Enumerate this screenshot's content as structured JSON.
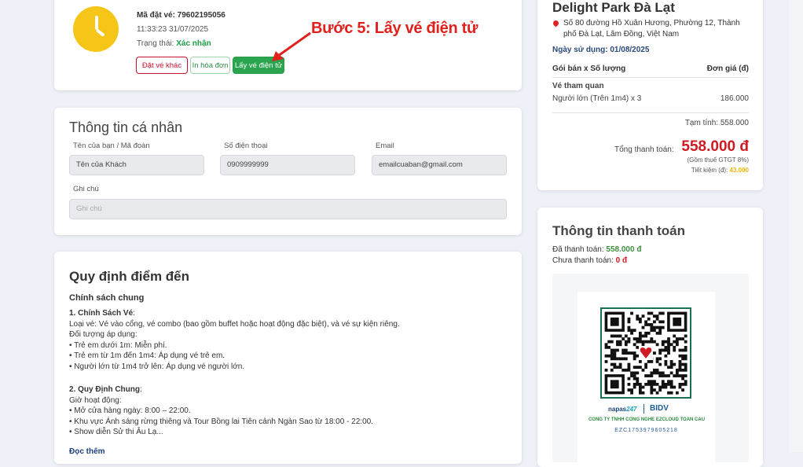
{
  "ticket": {
    "code_label": "Mã đặt vé: 79602195056",
    "datetime": "11:33:23 31/07/2025",
    "status_label": "Trạng thái: ",
    "status_value": "Xác nhận",
    "btn_book_again": "Đặt vé khác",
    "btn_print": "In hóa đơn",
    "btn_eticket": "Lấy vé điện tử"
  },
  "annotation": "Bước 5: Lấy vé điện tử",
  "personal": {
    "title": "Thông tin cá nhân",
    "name_label": "Tên của bạn / Mã đoàn",
    "name_value": "Tên của Khách",
    "phone_label": "Số điện thoại",
    "phone_value": "0909999999",
    "email_label": "Email",
    "email_value": "emailcuaban@gmail.com",
    "note_label": "Ghi chú",
    "note_placeholder": "Ghi chú"
  },
  "policy": {
    "title": "Quy định điểm đến",
    "subtitle": "Chính sách chung",
    "s1_title": "1. Chính Sách Vé",
    "s1_colon": ":",
    "s1_l1": "Loại vé: Vé vào cổng, vé combo (bao gồm buffet hoặc hoạt động đặc biệt), và vé sự kiện riêng.",
    "s1_l2": "Đối tượng áp dụng:",
    "s1_l3": "• Trẻ em dưới 1m: Miễn phí.",
    "s1_l4": "• Trẻ em từ 1m đến 1m4: Áp dụng vé trẻ em.",
    "s1_l5": "• Người lớn từ 1m4 trở lên: Áp dụng vé người lớn.",
    "s2_title": "2. Quy Định Chung",
    "s2_colon": ":",
    "s2_l1": "Giờ hoạt động:",
    "s2_l2": "• Mở cửa hàng ngày: 8:00 – 22:00.",
    "s2_l3": "• Khu vực Ánh sáng rừng thiêng và Tour Bồng lai Tiên cảnh Ngàn Sao từ 18:00 - 22:00.",
    "s2_l4": "• Show diễn Sử thi Âu Lạ...",
    "read_more": "Đọc thêm"
  },
  "park": {
    "name": "Delight Park Đà Lạt",
    "address": "Số 80 đường Hồ Xuân Hương, Phường 12, Thành phố Đà Lạt, Lâm Đồng, Việt Nam",
    "use_date": "Ngày sử dụng: 01/08/2025",
    "col_package": "Gói bán x Số lượng",
    "col_price": "Đơn giá (đ)",
    "item_group": "Vé tham quan",
    "item_name": "Người lớn (Trên 1m4) x 3",
    "item_price": "186.000",
    "subtotal": "Tạm tính: 558.000",
    "total_label": "Tổng thanh toán:",
    "total_value": "558.000 đ",
    "vat_note": "(Gồm thuế GTGT 8%)",
    "saving_label": "Tiết kiệm (đ): ",
    "saving_value": "43.000"
  },
  "payment": {
    "title": "Thông tin thanh toán",
    "paid_label": "Đã thanh toán: ",
    "paid_value": "558.000 đ",
    "unpaid_label": "Chưa thanh toán: ",
    "unpaid_value": "0 đ",
    "napas": "napas",
    "napas_num": "247",
    "bidv": "BIDV",
    "company": "CONG TY TNHH CONG NGHE EZCLOUD TOAN CAU",
    "ref": "EZC1753979605218"
  },
  "colors": {
    "accent_red": "#d01a22",
    "accent_green": "#2aa44f",
    "clock_yellow": "#f5c518",
    "annotation_red": "#e0211d"
  }
}
